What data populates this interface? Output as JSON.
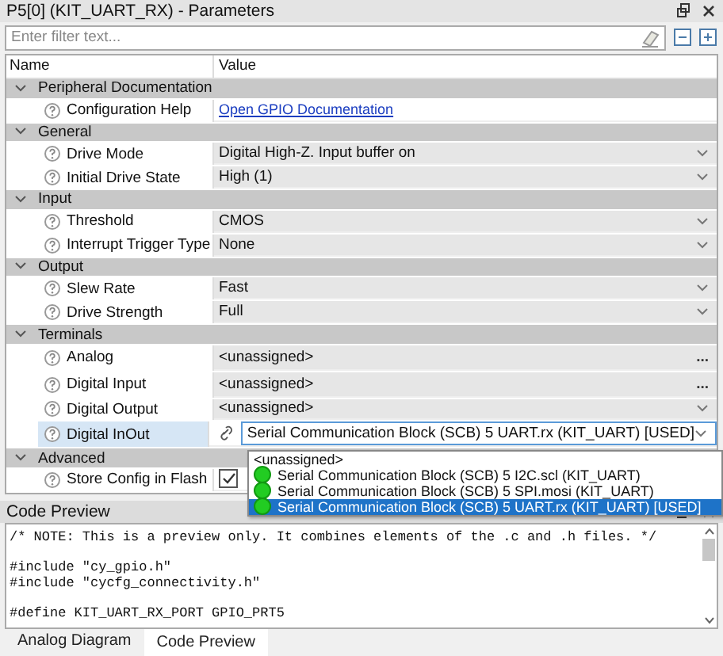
{
  "window": {
    "title": "P5[0] (KIT_UART_RX) - Parameters"
  },
  "filter": {
    "placeholder": "Enter filter text..."
  },
  "columns": [
    "Name",
    "Value"
  ],
  "sections": [
    {
      "title": "Peripheral Documentation",
      "expanded": true,
      "rows": [
        {
          "label": "Configuration Help",
          "kind": "link",
          "value": "Open GPIO Documentation",
          "selected": false
        }
      ]
    },
    {
      "title": "General",
      "expanded": true,
      "rows": [
        {
          "label": "Drive Mode",
          "kind": "dropdown",
          "value": "Digital High-Z. Input buffer on",
          "selected": false
        },
        {
          "label": "Initial Drive State",
          "kind": "dropdown",
          "value": "High (1)",
          "selected": false
        }
      ]
    },
    {
      "title": "Input",
      "expanded": true,
      "rows": [
        {
          "label": "Threshold",
          "kind": "dropdown",
          "value": "CMOS",
          "selected": false
        },
        {
          "label": "Interrupt Trigger Type",
          "kind": "dropdown",
          "value": "None",
          "selected": false
        }
      ]
    },
    {
      "title": "Output",
      "expanded": true,
      "rows": [
        {
          "label": "Slew Rate",
          "kind": "dropdown",
          "value": "Fast",
          "selected": false
        },
        {
          "label": "Drive Strength",
          "kind": "dropdown",
          "value": "Full",
          "selected": false
        }
      ]
    },
    {
      "title": "Terminals",
      "expanded": true,
      "rows": [
        {
          "label": "Analog",
          "kind": "browse",
          "value": "<unassigned>",
          "button": "...",
          "selected": false
        },
        {
          "label": "Digital Input",
          "kind": "browse",
          "value": "<unassigned>",
          "button": "...",
          "selected": false
        },
        {
          "label": "Digital Output",
          "kind": "dropdown",
          "value": "<unassigned>",
          "selected": false
        },
        {
          "label": "Digital InOut",
          "kind": "linked",
          "value": "Serial Communication Block (SCB) 5 UART.rx (KIT_UART) [USED]",
          "selected": true
        }
      ]
    },
    {
      "title": "Advanced",
      "expanded": true,
      "rows": [
        {
          "label": "Store Config in Flash",
          "kind": "checkbox",
          "checked": true,
          "selected": false
        }
      ]
    }
  ],
  "dropdown_list": [
    {
      "label": "<unassigned>",
      "kind": "plain",
      "selected": false
    },
    {
      "label": "Serial Communication Block (SCB) 5 I2C.scl (KIT_UART)",
      "kind": "dot",
      "selected": false
    },
    {
      "label": "Serial Communication Block (SCB) 5 SPI.mosi (KIT_UART)",
      "kind": "dot",
      "selected": false
    },
    {
      "label": "Serial Communication Block (SCB) 5 UART.rx (KIT_UART) [USED]",
      "kind": "dot",
      "selected": true
    }
  ],
  "code_preview": {
    "title": "Code Preview",
    "blocks": [
      [
        "/* NOTE: This is a preview only. It combines elements of the .c and .h files. */"
      ],
      [
        "#include \"cy_gpio.h\"",
        "#include \"cycfg_connectivity.h\""
      ],
      [
        "#define KIT_UART_RX_PORT GPIO_PRT5"
      ]
    ]
  },
  "bottom_tabs": [
    {
      "label": "Analog Diagram",
      "selected": false
    },
    {
      "label": "Code Preview",
      "selected": true
    }
  ]
}
